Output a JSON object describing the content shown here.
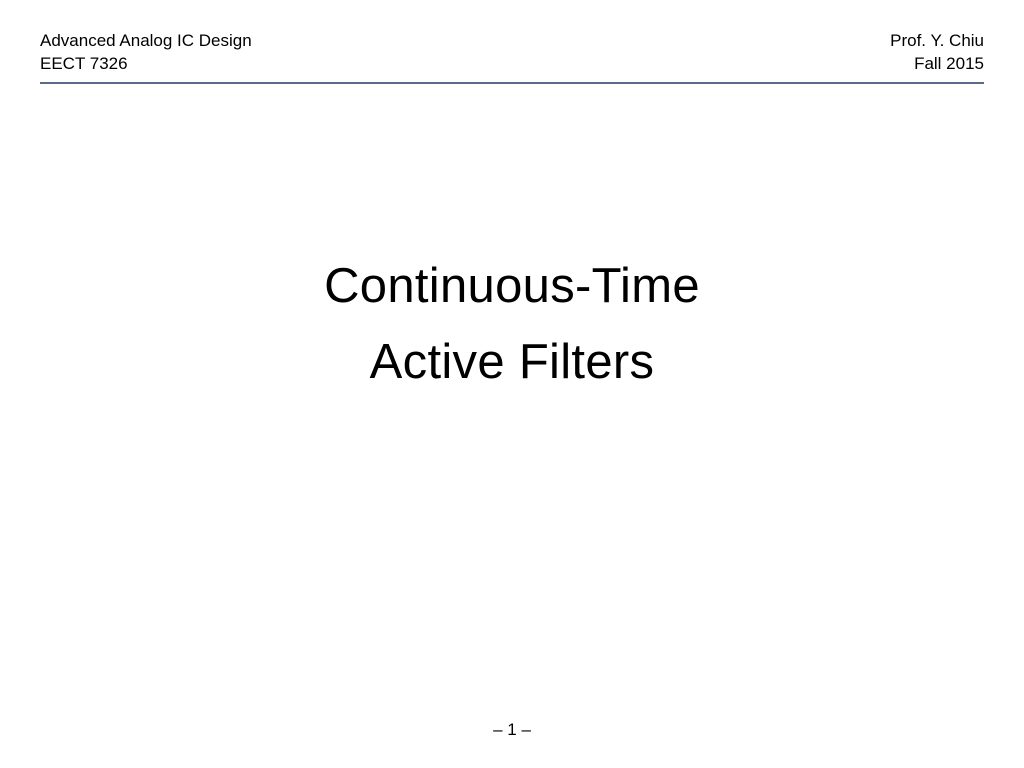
{
  "header": {
    "left": {
      "line1": "Advanced Analog IC Design",
      "line2": "EECT 7326"
    },
    "right": {
      "line1": "Prof. Y. Chiu",
      "line2": "Fall 2015"
    }
  },
  "title": {
    "line1": "Continuous-Time",
    "line2": "Active Filters"
  },
  "page_number": "– 1 –"
}
